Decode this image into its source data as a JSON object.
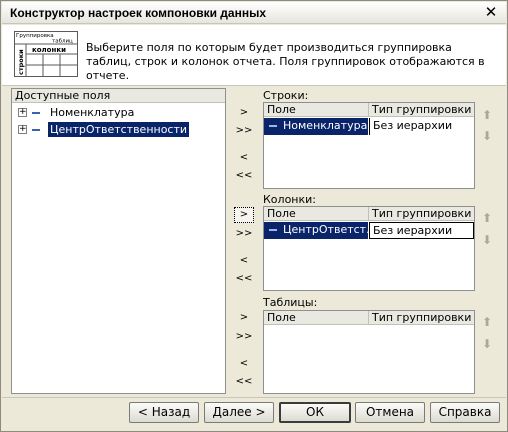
{
  "window": {
    "title": "Конструктор настроек компоновки данных",
    "close_glyph": "✕"
  },
  "header": {
    "icon_text": {
      "grouping": "Группировка",
      "tables": "таблиц",
      "columns": "колонки",
      "rows": "строки"
    },
    "description": "Выберите поля по которым будет производиться группировка таблиц, строк и колонок отчета. Поля группировок отображаются в отчете."
  },
  "available": {
    "header": "Доступные поля",
    "items": [
      {
        "label": "Номенклатура",
        "selected": false
      },
      {
        "label": "ЦентрОтветственности",
        "selected": true
      }
    ]
  },
  "rows_panel": {
    "label": "Строки:",
    "col_field": "Поле",
    "col_type": "Тип группировки",
    "items": [
      {
        "field": "Номенклатура",
        "type": "Без иерархии"
      }
    ]
  },
  "columns_panel": {
    "label": "Колонки:",
    "col_field": "Поле",
    "col_type": "Тип группировки",
    "items": [
      {
        "field": "ЦентрОтветст...",
        "type": "Без иерархии"
      }
    ]
  },
  "tables_panel": {
    "label": "Таблицы:",
    "col_field": "Поле",
    "col_type": "Тип группировки",
    "items": []
  },
  "arrows": {
    "add": ">",
    "add_all": ">>",
    "remove": "<",
    "remove_all": "<<",
    "up": "⬆",
    "down": "⬇"
  },
  "buttons": {
    "back": "< Назад",
    "next": "Далее >",
    "ok": "ОК",
    "cancel": "Отмена",
    "help": "Справка"
  }
}
